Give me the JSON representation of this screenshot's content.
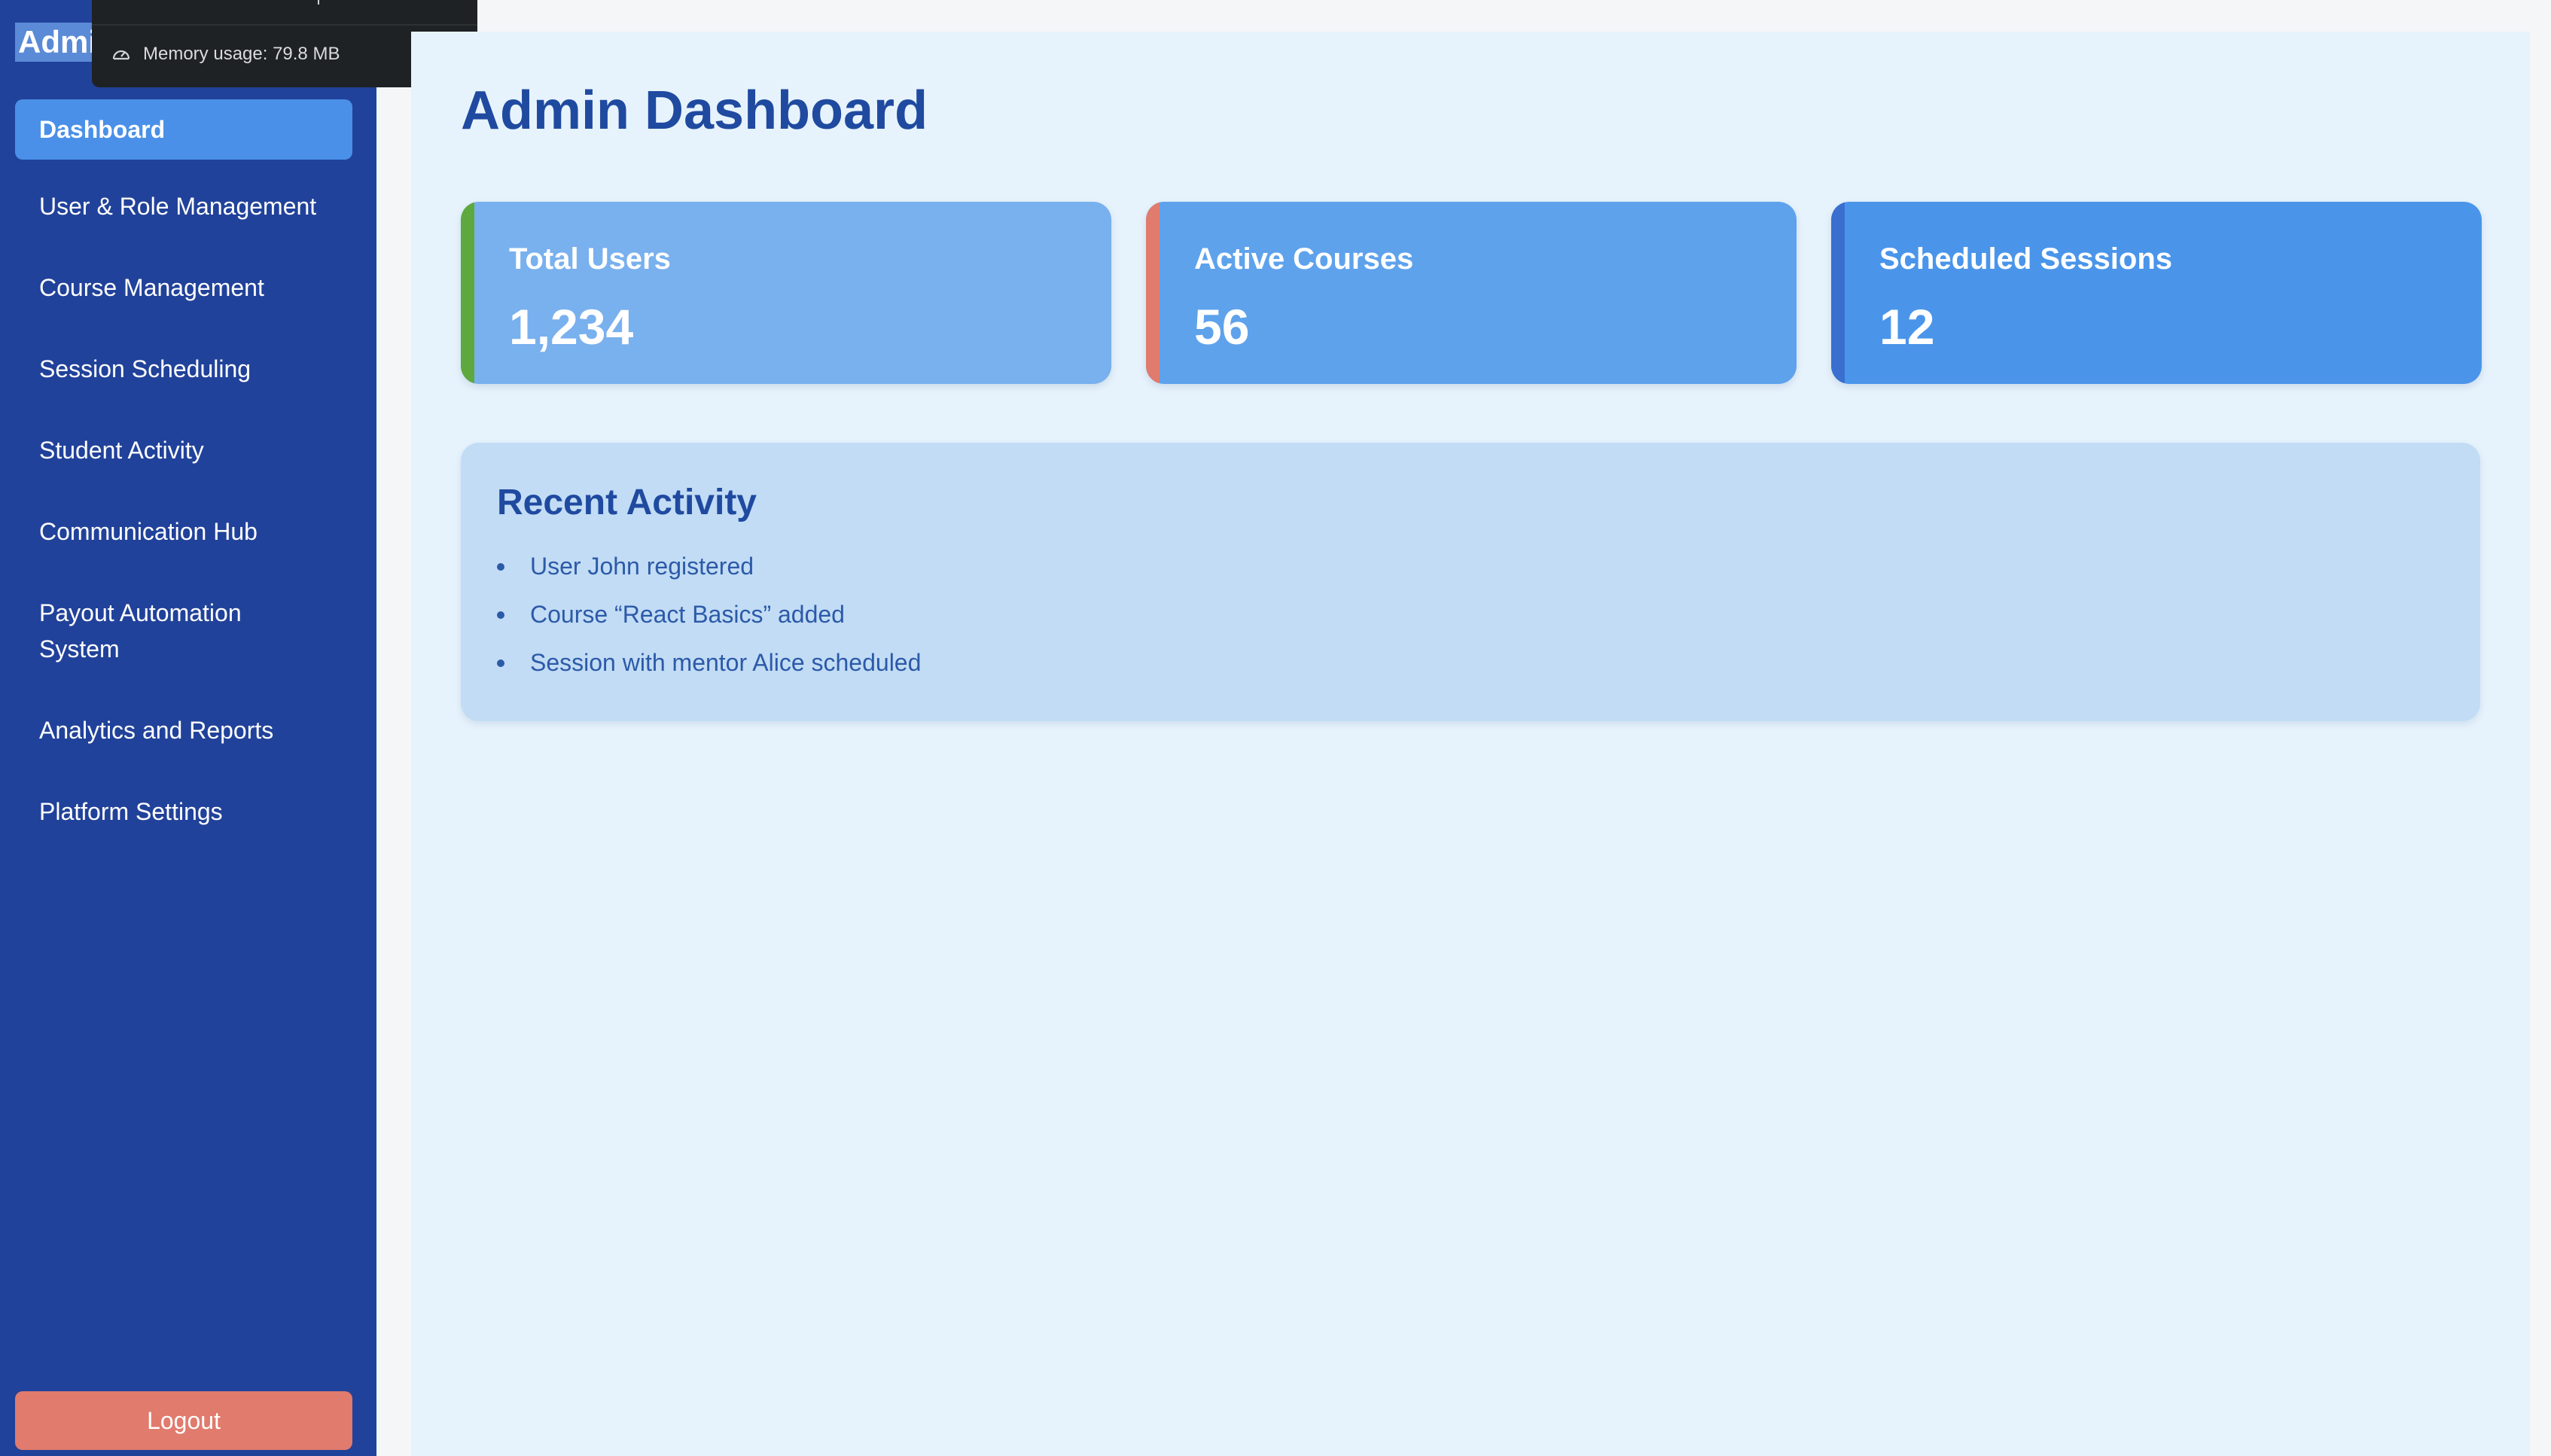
{
  "sidebar": {
    "brand": "Admi",
    "items": [
      {
        "label": "Dashboard"
      },
      {
        "label": "User & Role Management"
      },
      {
        "label": "Course Management"
      },
      {
        "label": "Session Scheduling"
      },
      {
        "label": "Student Activity"
      },
      {
        "label": "Communication Hub"
      },
      {
        "label": "Payout Automation System"
      },
      {
        "label": "Analytics and Reports"
      },
      {
        "label": "Platform Settings"
      }
    ],
    "active_index": 0,
    "logout_label": "Logout"
  },
  "memory_tooltip": {
    "text": "Memory usage: 79.8 MB",
    "icon": "gauge-icon"
  },
  "main": {
    "title": "Admin Dashboard",
    "cards": [
      {
        "label": "Total Users",
        "value": "1,234",
        "bg": "#79b0ee",
        "accent": "#5ea93e"
      },
      {
        "label": "Active Courses",
        "value": "56",
        "bg": "#5ea2ec",
        "accent": "#e07b6d"
      },
      {
        "label": "Scheduled Sessions",
        "value": "12",
        "bg": "#4a95ea",
        "accent": "#3a6fd0"
      }
    ],
    "recent_activity": {
      "title": "Recent Activity",
      "items": [
        "User John registered",
        "Course “React Basics” added",
        "Session with mentor Alice scheduled"
      ]
    }
  },
  "colors": {
    "sidebar_bg": "#21429a",
    "active_nav": "#4a90e8",
    "logout_bg": "#e07b6d",
    "main_bg": "#e7f3fc",
    "title_color": "#1f4aa0"
  }
}
